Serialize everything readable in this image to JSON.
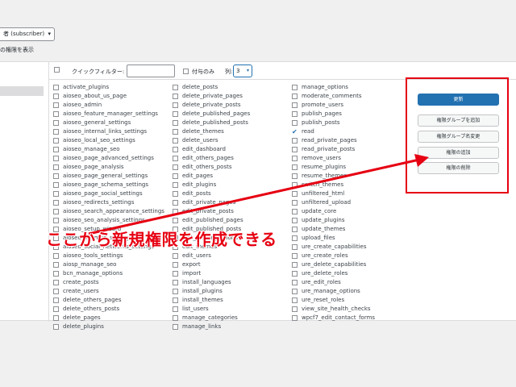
{
  "role_select": {
    "value": "者 (subscriber)"
  },
  "role_note": "の権限を表示",
  "filter": {
    "label": "クイックフィルター:",
    "own_only_label": "付与のみ",
    "columns_label": "列:",
    "columns_value": "3"
  },
  "capabilities": {
    "col1": [
      "activate_plugins",
      "aioseo_about_us_page",
      "aioseo_admin",
      "aioseo_feature_manager_settings",
      "aioseo_general_settings",
      "aioseo_internal_links_settings",
      "aioseo_local_seo_settings",
      "aioseo_manage_seo",
      "aioseo_page_advanced_settings",
      "aioseo_page_analysis",
      "aioseo_page_general_settings",
      "aioseo_page_schema_settings",
      "aioseo_page_social_settings",
      "aioseo_redirects_settings",
      "aioseo_search_appearance_settings",
      "aioseo_seo_analysis_settings",
      "aioseo_setup_wizard",
      "aioseo_sitemap_settings",
      "aioseo_social_networks_settings",
      "aioseo_tools_settings",
      "aiosp_manage_seo",
      "bcn_manage_options",
      "create_posts",
      "create_users",
      "delete_others_pages",
      "delete_others_posts",
      "delete_pages",
      "delete_plugins"
    ],
    "col2": [
      "delete_posts",
      "delete_private_pages",
      "delete_private_posts",
      "delete_published_pages",
      "delete_published_posts",
      "delete_themes",
      "delete_users",
      "edit_dashboard",
      "edit_others_pages",
      "edit_others_posts",
      "edit_pages",
      "edit_plugins",
      "edit_posts",
      "edit_private_pages",
      "edit_private_posts",
      "edit_published_pages",
      "edit_published_posts",
      "edit_theme_options",
      "edit_themes",
      "edit_users",
      "export",
      "import",
      "install_languages",
      "install_plugins",
      "install_themes",
      "list_users",
      "manage_categories",
      "manage_links"
    ],
    "col3": [
      "manage_options",
      "moderate_comments",
      "promote_users",
      "publish_pages",
      "publish_posts",
      "read",
      "read_private_pages",
      "read_private_posts",
      "remove_users",
      "resume_plugins",
      "resume_themes",
      "switch_themes",
      "unfiltered_html",
      "unfiltered_upload",
      "update_core",
      "update_plugins",
      "update_themes",
      "upload_files",
      "ure_create_capabilities",
      "ure_create_roles",
      "ure_delete_capabilities",
      "ure_delete_roles",
      "ure_edit_roles",
      "ure_manage_options",
      "ure_reset_roles",
      "view_site_health_checks",
      "wpcf7_edit_contact_forms"
    ],
    "checked": [
      "read"
    ]
  },
  "actions": {
    "update": "更新",
    "add_group": "権限グループを追加",
    "rename_group": "権限グループ名変更",
    "add_capability": "権限の追加",
    "delete_capability": "権限の削除"
  },
  "annotation": {
    "callout": "ここから新規権限を作成できる",
    "color": "#e60012"
  },
  "colors": {
    "primary": "#2271b1"
  }
}
